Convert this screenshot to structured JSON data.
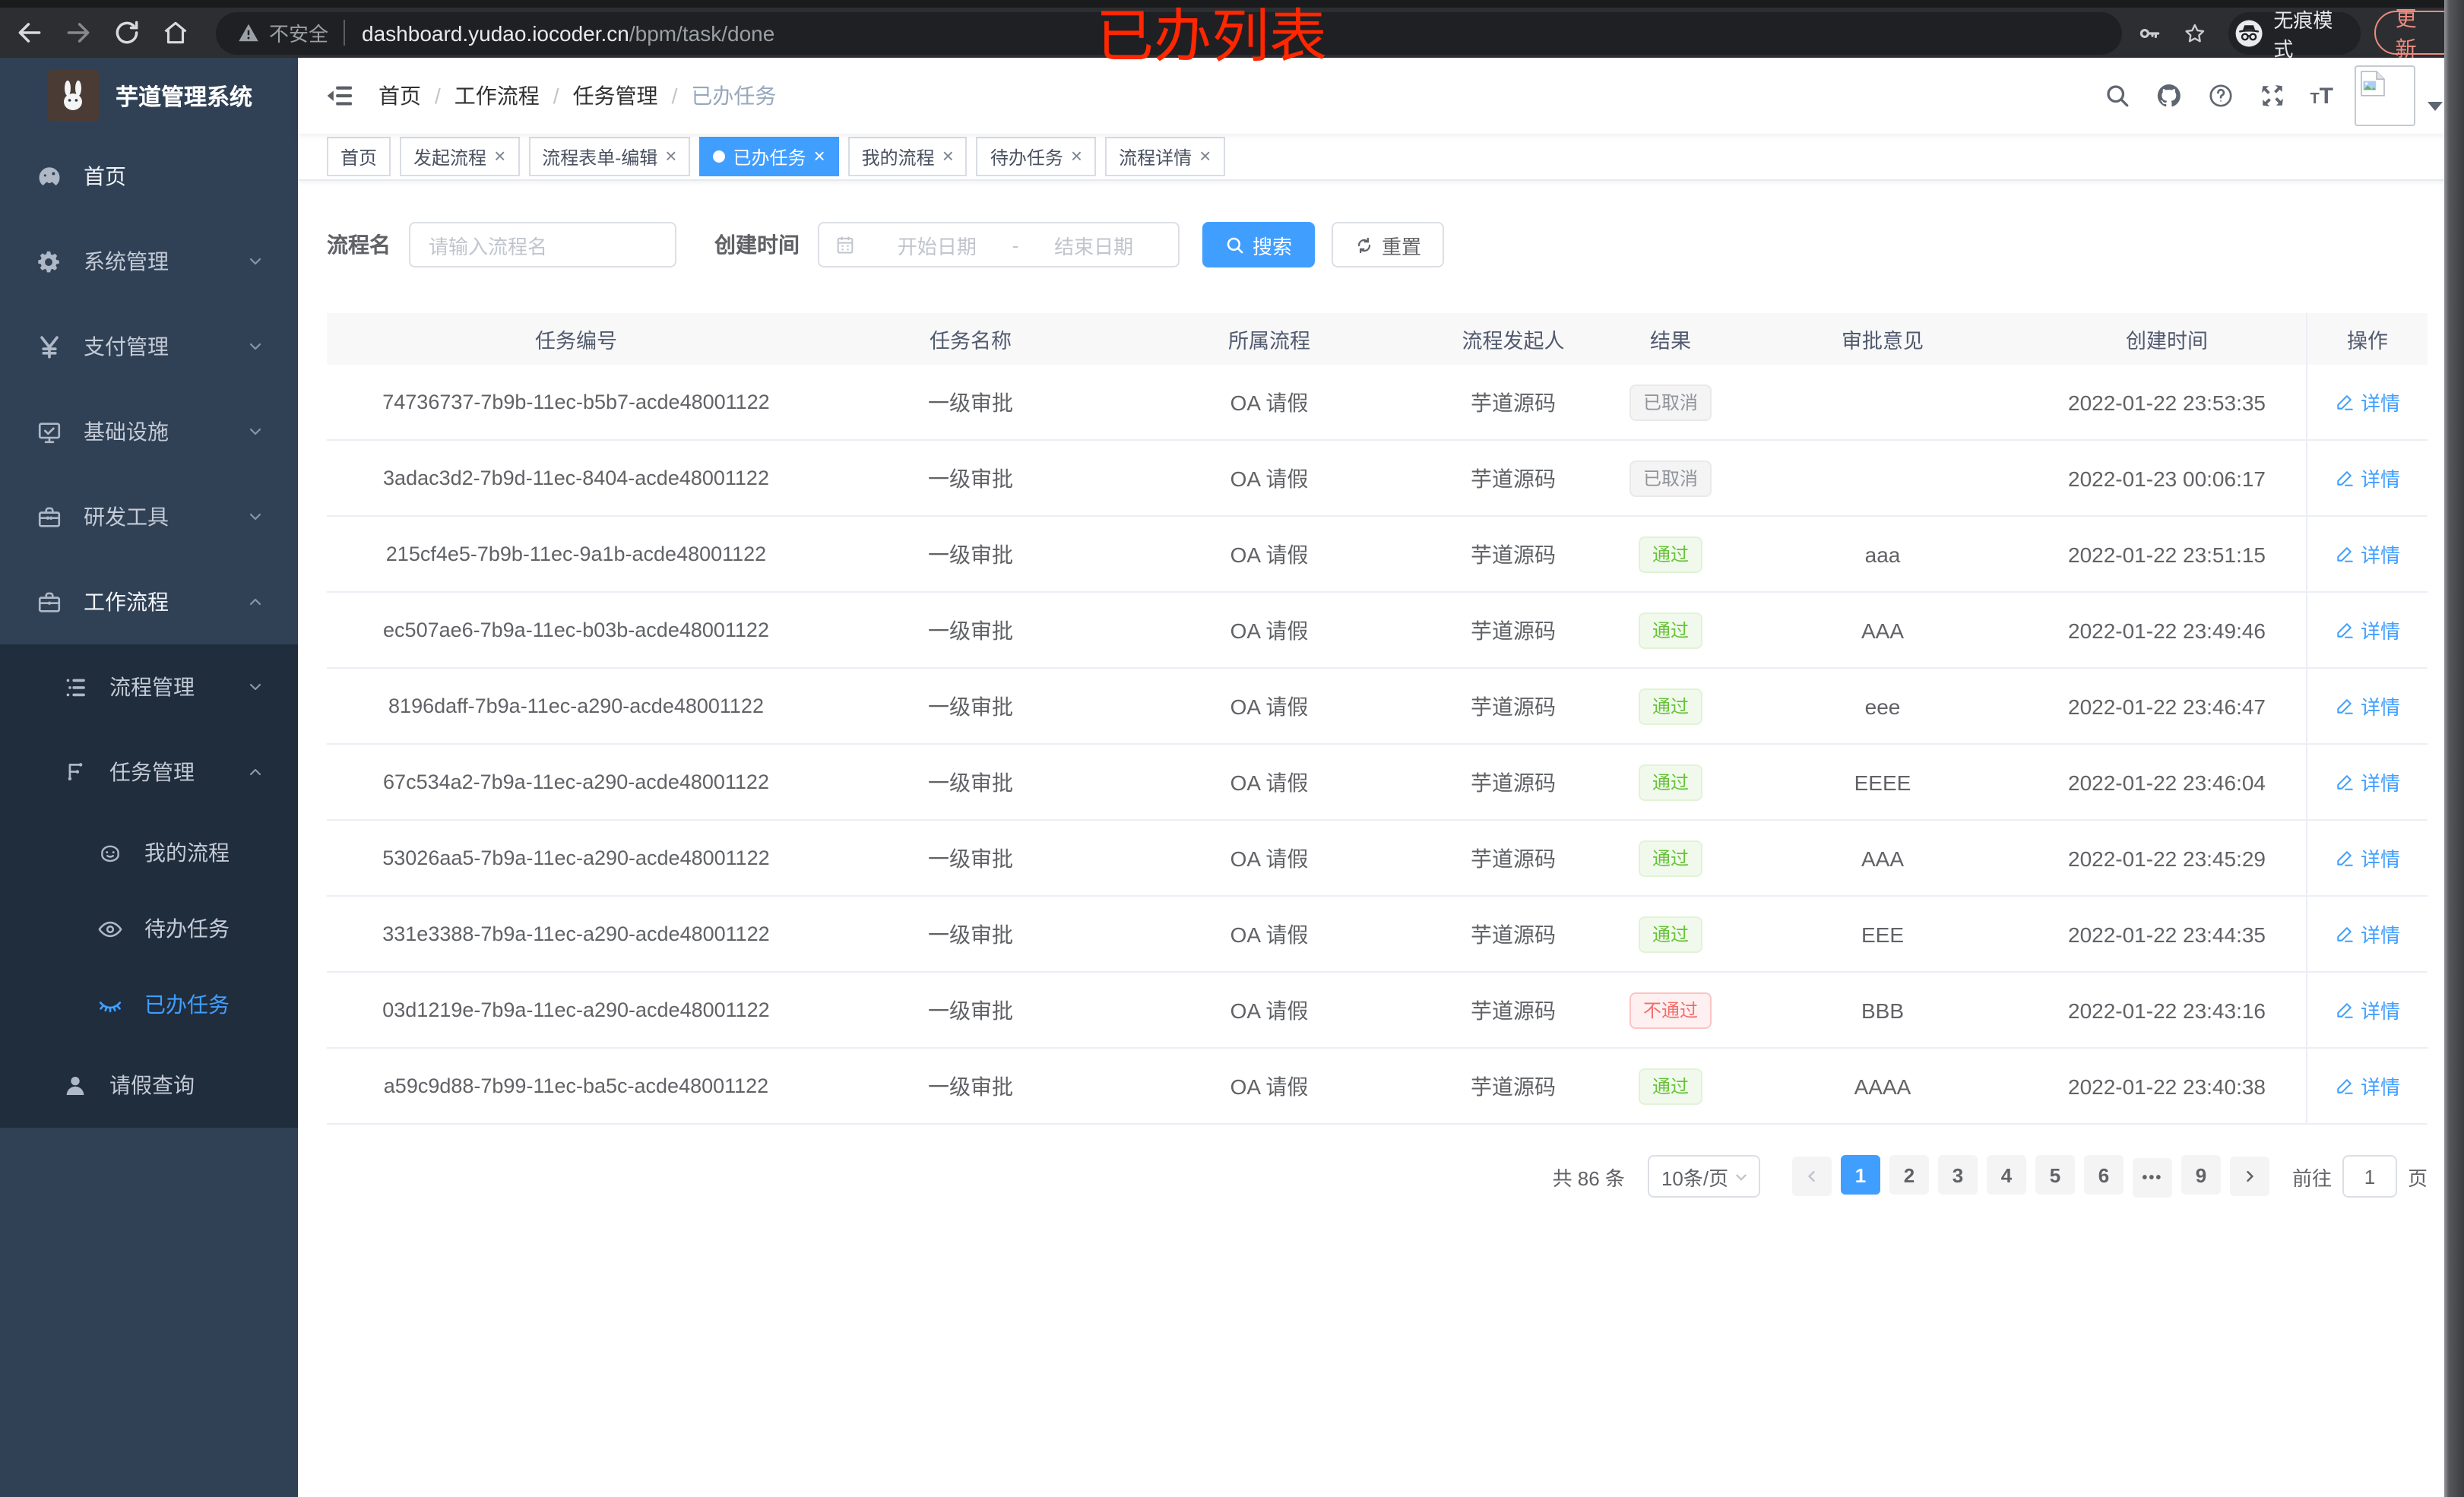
{
  "browser": {
    "security_label": "不安全",
    "url_host": "dashboard.yudao.iocoder.cn",
    "url_path": "/bpm/task/done",
    "incognito_label": "无痕模式",
    "update_label": "更新"
  },
  "annotation": {
    "text": "已办列表",
    "color": "#ff2600"
  },
  "sidebar": {
    "app_title": "芋道管理系统",
    "menu": [
      {
        "key": "home",
        "label": "首页",
        "icon": "gauge-icon",
        "level": 0,
        "bright": true
      },
      {
        "key": "system",
        "label": "系统管理",
        "icon": "gear-icon",
        "level": 0,
        "chevron": "down"
      },
      {
        "key": "payment",
        "label": "支付管理",
        "icon": "yen-icon",
        "level": 0,
        "chevron": "down"
      },
      {
        "key": "infrastructure",
        "label": "基础设施",
        "icon": "monitor-icon",
        "level": 0,
        "chevron": "down"
      },
      {
        "key": "dev-tools",
        "label": "研发工具",
        "icon": "toolbox-icon",
        "level": 0,
        "chevron": "down"
      },
      {
        "key": "workflow",
        "label": "工作流程",
        "icon": "briefcase-icon",
        "level": 0,
        "chevron": "up",
        "bright": true
      },
      {
        "key": "process-mgmt",
        "label": "流程管理",
        "icon": "list-tree-icon",
        "level": 1,
        "chevron": "down",
        "dark": true
      },
      {
        "key": "task-mgmt",
        "label": "任务管理",
        "icon": "flow-icon",
        "level": 1,
        "chevron": "up",
        "dark": true
      },
      {
        "key": "my-process",
        "label": "我的流程",
        "icon": "robot-icon",
        "level": 2,
        "dark": true
      },
      {
        "key": "todo-tasks",
        "label": "待办任务",
        "icon": "eye-icon",
        "level": 2,
        "dark": true
      },
      {
        "key": "done-tasks",
        "label": "已办任务",
        "icon": "eye-closed-icon",
        "level": 2,
        "dark": true,
        "active": true
      },
      {
        "key": "leave-query",
        "label": "请假查询",
        "icon": "user-icon",
        "level": 1,
        "dark": true
      }
    ]
  },
  "navbar": {
    "breadcrumb": [
      "首页",
      "工作流程",
      "任务管理",
      "已办任务"
    ],
    "breadcrumb_separator": "/"
  },
  "tabs": [
    {
      "key": "home",
      "label": "首页",
      "closable": false,
      "active": false
    },
    {
      "key": "start-process",
      "label": "发起流程",
      "closable": true,
      "active": false
    },
    {
      "key": "form-edit",
      "label": "流程表单-编辑",
      "closable": true,
      "active": false
    },
    {
      "key": "done-tasks",
      "label": "已办任务",
      "closable": true,
      "active": true
    },
    {
      "key": "my-process",
      "label": "我的流程",
      "closable": true,
      "active": false
    },
    {
      "key": "todo-tasks",
      "label": "待办任务",
      "closable": true,
      "active": false
    },
    {
      "key": "process-detail",
      "label": "流程详情",
      "closable": true,
      "active": false
    }
  ],
  "filters": {
    "name_label": "流程名",
    "name_placeholder": "请输入流程名",
    "time_label": "创建时间",
    "start_placeholder": "开始日期",
    "range_separator": "-",
    "end_placeholder": "结束日期",
    "search_label": "搜索",
    "reset_label": "重置"
  },
  "table": {
    "columns": [
      "任务编号",
      "任务名称",
      "所属流程",
      "流程发起人",
      "结果",
      "审批意见",
      "创建时间",
      "操作"
    ],
    "action_label": "详情",
    "rows": [
      {
        "id": "74736737-7b9b-11ec-b5b7-acde48001122",
        "name": "一级审批",
        "process": "OA 请假",
        "initiator": "芋道源码",
        "result": "已取消",
        "result_type": "cancelled",
        "comment": "",
        "created": "2022-01-22 23:53:35"
      },
      {
        "id": "3adac3d2-7b9d-11ec-8404-acde48001122",
        "name": "一级审批",
        "process": "OA 请假",
        "initiator": "芋道源码",
        "result": "已取消",
        "result_type": "cancelled",
        "comment": "",
        "created": "2022-01-23 00:06:17"
      },
      {
        "id": "215cf4e5-7b9b-11ec-9a1b-acde48001122",
        "name": "一级审批",
        "process": "OA 请假",
        "initiator": "芋道源码",
        "result": "通过",
        "result_type": "pass",
        "comment": "aaa",
        "created": "2022-01-22 23:51:15"
      },
      {
        "id": "ec507ae6-7b9a-11ec-b03b-acde48001122",
        "name": "一级审批",
        "process": "OA 请假",
        "initiator": "芋道源码",
        "result": "通过",
        "result_type": "pass",
        "comment": "AAA",
        "created": "2022-01-22 23:49:46"
      },
      {
        "id": "8196daff-7b9a-11ec-a290-acde48001122",
        "name": "一级审批",
        "process": "OA 请假",
        "initiator": "芋道源码",
        "result": "通过",
        "result_type": "pass",
        "comment": "eee",
        "created": "2022-01-22 23:46:47"
      },
      {
        "id": "67c534a2-7b9a-11ec-a290-acde48001122",
        "name": "一级审批",
        "process": "OA 请假",
        "initiator": "芋道源码",
        "result": "通过",
        "result_type": "pass",
        "comment": "EEEE",
        "created": "2022-01-22 23:46:04"
      },
      {
        "id": "53026aa5-7b9a-11ec-a290-acde48001122",
        "name": "一级审批",
        "process": "OA 请假",
        "initiator": "芋道源码",
        "result": "通过",
        "result_type": "pass",
        "comment": "AAA",
        "created": "2022-01-22 23:45:29"
      },
      {
        "id": "331e3388-7b9a-11ec-a290-acde48001122",
        "name": "一级审批",
        "process": "OA 请假",
        "initiator": "芋道源码",
        "result": "通过",
        "result_type": "pass",
        "comment": "EEE",
        "created": "2022-01-22 23:44:35"
      },
      {
        "id": "03d1219e-7b9a-11ec-a290-acde48001122",
        "name": "一级审批",
        "process": "OA 请假",
        "initiator": "芋道源码",
        "result": "不通过",
        "result_type": "fail",
        "comment": "BBB",
        "created": "2022-01-22 23:43:16"
      },
      {
        "id": "a59c9d88-7b99-11ec-ba5c-acde48001122",
        "name": "一级审批",
        "process": "OA 请假",
        "initiator": "芋道源码",
        "result": "通过",
        "result_type": "pass",
        "comment": "AAAA",
        "created": "2022-01-22 23:40:38"
      }
    ]
  },
  "pagination": {
    "total_label": "共 86 条",
    "page_size_label": "10条/页",
    "pages": [
      "1",
      "2",
      "3",
      "4",
      "5",
      "6",
      "•••",
      "9"
    ],
    "active_page": "1",
    "goto_label": "前往",
    "goto_value": "1",
    "unit_label": "页"
  },
  "colors": {
    "accent": "#409eff",
    "success": "#67c23a",
    "danger": "#f56c6c",
    "info": "#909399",
    "sidebar_bg": "#304156",
    "submenu_bg": "#1f2d3d",
    "annotation_red": "#ff2600",
    "update_red": "#ee8b80"
  }
}
